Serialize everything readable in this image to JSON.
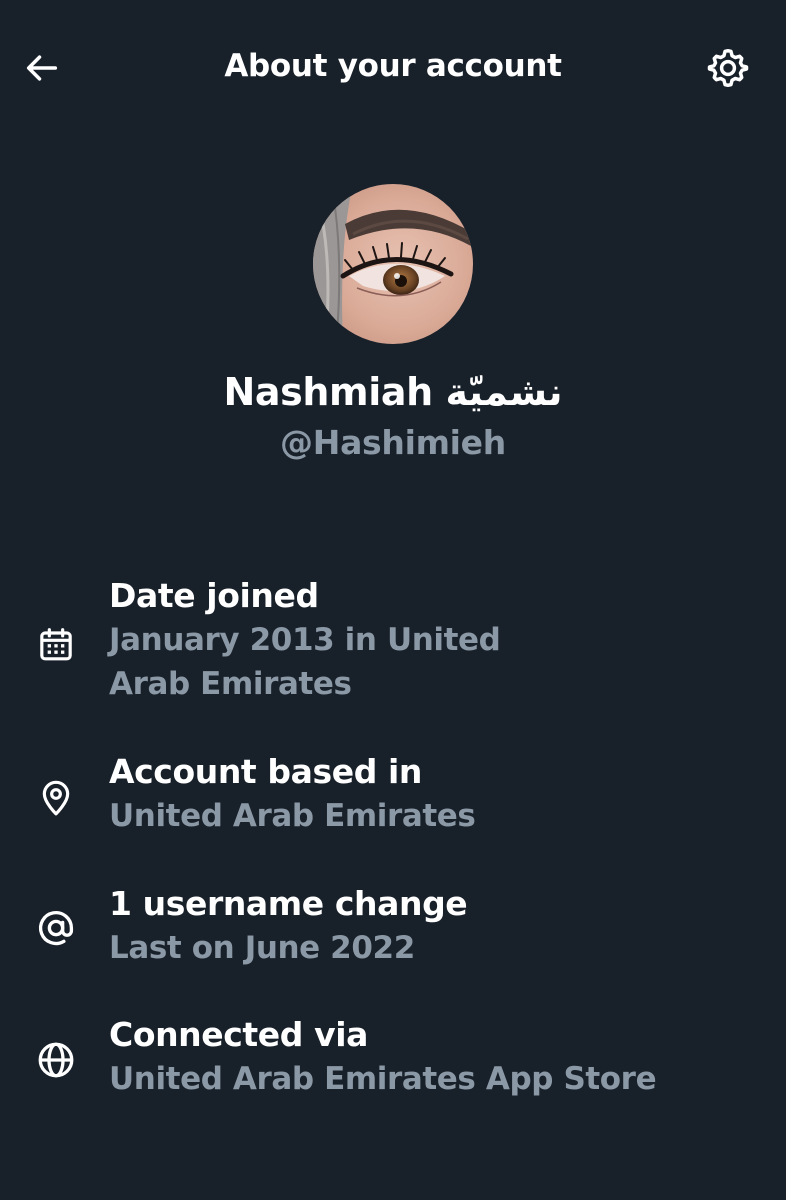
{
  "header": {
    "title": "About your account",
    "back_icon": "arrow-left-icon",
    "settings_icon": "gear-icon"
  },
  "profile": {
    "display_name": "Nashmiah نشميّة",
    "handle": "@Hashimieh"
  },
  "info": {
    "date_joined": {
      "icon": "calendar-icon",
      "label": "Date joined",
      "value_line1": "January 2013 in United",
      "value_line2": "Arab Emirates"
    },
    "account_based": {
      "icon": "location-pin-icon",
      "label": "Account based in",
      "value": "United Arab Emirates"
    },
    "username_change": {
      "icon": "at-sign-icon",
      "label": "1 username change",
      "value": "Last on June 2022"
    },
    "connected_via": {
      "icon": "globe-icon",
      "label": "Connected via",
      "value": "United Arab Emirates App Store"
    }
  },
  "colors": {
    "background": "#18202a",
    "primary_text": "#ffffff",
    "secondary_text": "#8b98a5"
  }
}
